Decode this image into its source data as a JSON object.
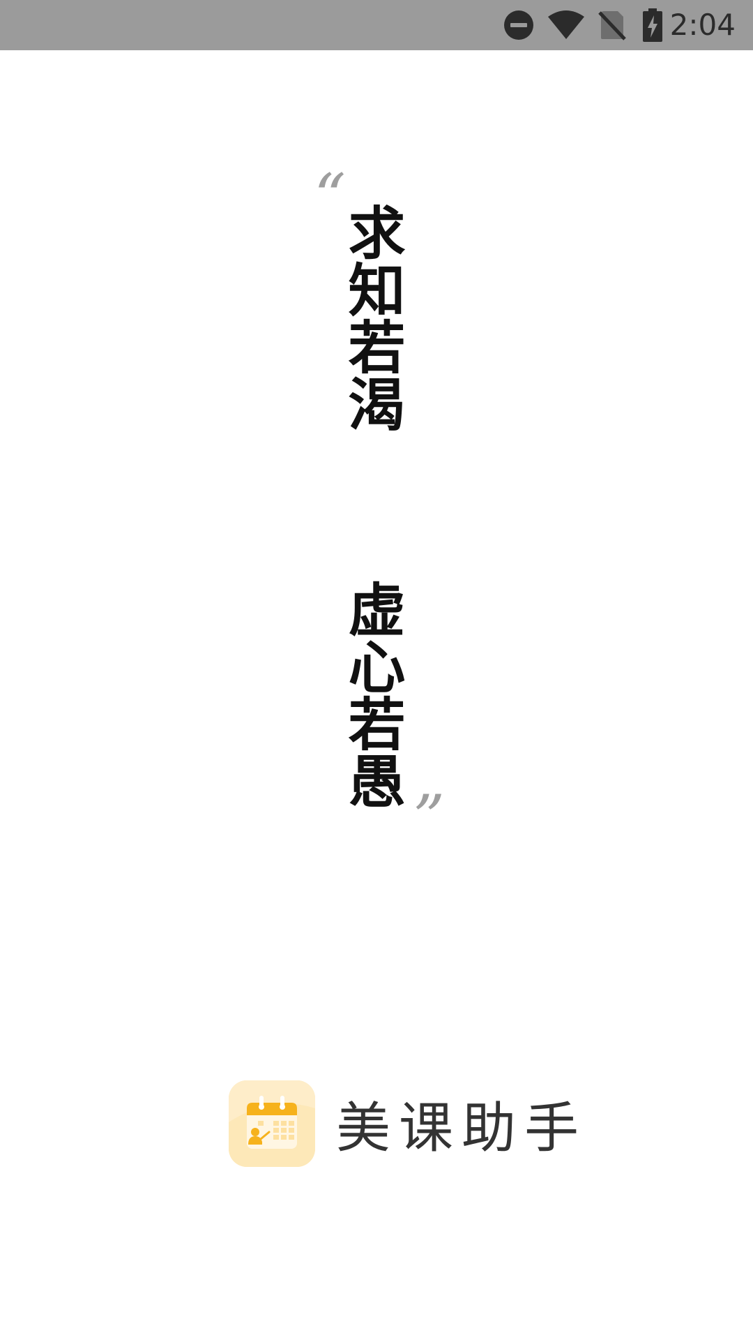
{
  "status_bar": {
    "time": "2:04",
    "icons": [
      "do-not-disturb-icon",
      "wifi-icon",
      "no-sim-icon",
      "battery-charging-icon"
    ]
  },
  "quote": {
    "open_mark": "“",
    "line1": "求知若渴",
    "line2": "虚心若愚",
    "close_mark": "”"
  },
  "brand": {
    "app_name": "美课助手",
    "logo_icon": "calendar-teacher-icon"
  },
  "colors": {
    "status_bar_bg": "#9b9b9b",
    "logo_bg": "#fde8b8",
    "logo_accent": "#f6b21c"
  }
}
